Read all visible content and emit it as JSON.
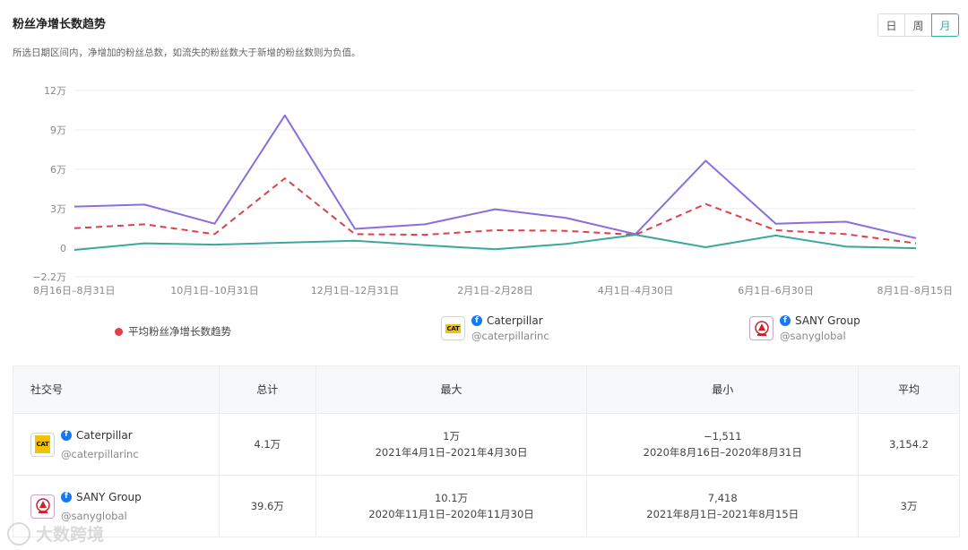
{
  "header": {
    "title": "粉丝净增长数趋势",
    "subtitle": "所选日期区间内，净增加的粉丝总数，如流失的粉丝数大于新增的粉丝数则为负值。",
    "period_tabs": [
      {
        "label": "日",
        "active": false
      },
      {
        "label": "周",
        "active": false
      },
      {
        "label": "月",
        "active": true
      }
    ]
  },
  "chart_data": {
    "type": "line",
    "y_tick_labels": [
      "12万",
      "9万",
      "6万",
      "3万",
      "0",
      "−2.2万"
    ],
    "y_ticks": [
      120000,
      90000,
      60000,
      30000,
      0,
      -22000
    ],
    "ylim": [
      -22000,
      120000
    ],
    "x_tick_labels": [
      "8月16日–8月31日",
      "10月1日–10月31日",
      "12月1日–12月31日",
      "2月1日–2月28日",
      "4月1日–4月30日",
      "6月1日–6月30日",
      "8月1日–8月15日"
    ],
    "x_tick_indices": [
      0,
      2,
      4,
      6,
      8,
      10,
      12
    ],
    "point_count": 13,
    "series": [
      {
        "name": "SANY Group",
        "color": "#8a6fdc",
        "dashed": false,
        "values": [
          31500,
          33000,
          18500,
          101000,
          14500,
          18000,
          29500,
          23000,
          10500,
          66500,
          18500,
          20000,
          7418
        ]
      },
      {
        "name": "平均粉丝净增长数趋势",
        "color": "#e0404a",
        "dashed": true,
        "values": [
          15000,
          18000,
          10500,
          53000,
          10500,
          10000,
          13500,
          13000,
          10000,
          33500,
          13500,
          10500,
          3500
        ]
      },
      {
        "name": "Caterpillar",
        "color": "#3aa99a",
        "dashed": false,
        "values": [
          -1511,
          3500,
          2500,
          4000,
          5500,
          2000,
          -1000,
          3000,
          10000,
          500,
          9500,
          1000,
          -200
        ]
      }
    ],
    "legend": [
      {
        "type": "dot",
        "label": "平均粉丝净增长数趋势",
        "color": "#e0404a"
      },
      {
        "type": "account",
        "name": "Caterpillar",
        "handle": "@caterpillarinc",
        "logo": "cat-logo"
      },
      {
        "type": "account",
        "name": "SANY Group",
        "handle": "@sanyglobal",
        "logo": "sany-logo"
      }
    ],
    "grid": true
  },
  "table": {
    "headers": [
      "社交号",
      "总计",
      "最大",
      "最小",
      "平均"
    ],
    "rows": [
      {
        "name": "Caterpillar",
        "handle": "@caterpillarinc",
        "logo": "cat-logo",
        "total": "4.1万",
        "max_value": "1万",
        "max_period": "2021年4月1日–2021年4月30日",
        "min_value": "−1,511",
        "min_period": "2020年8月16日–2020年8月31日",
        "avg": "3,154.2"
      },
      {
        "name": "SANY Group",
        "handle": "@sanyglobal",
        "logo": "sany-logo",
        "total": "39.6万",
        "max_value": "10.1万",
        "max_period": "2020年11月1日–2020年11月30日",
        "min_value": "7,418",
        "min_period": "2021年8月1日–2021年8月15日",
        "avg": "3万"
      }
    ]
  },
  "cat_logo_text": "CAT",
  "watermark": "大数跨境",
  "icons": {
    "facebook": "facebook-icon",
    "cat": "cat-logo-icon",
    "sany": "sany-logo-icon"
  }
}
